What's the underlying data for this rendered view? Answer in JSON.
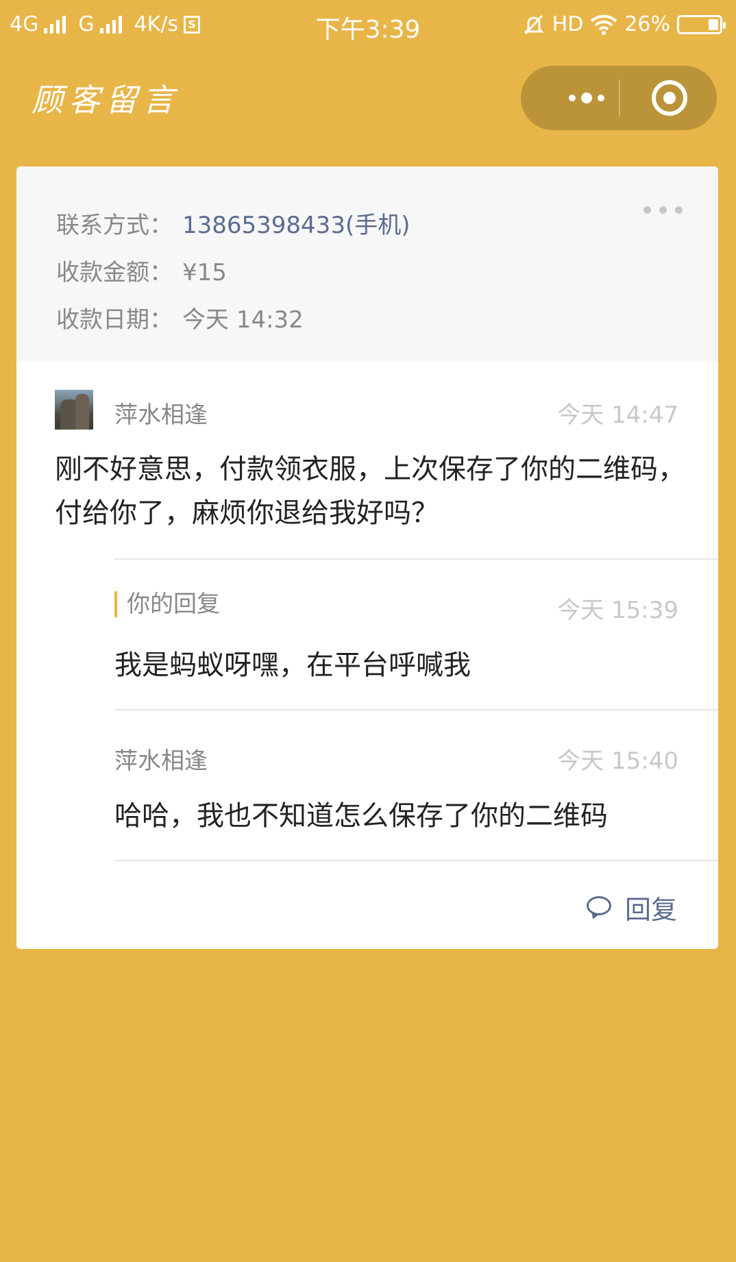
{
  "status_bar": {
    "network1": "4G",
    "network2": "G",
    "speed": "4K/s",
    "sim_icon": "S",
    "time": "下午3:39",
    "hd": "HD",
    "battery": "26%"
  },
  "header": {
    "title": "顾客留言"
  },
  "info": {
    "contact_label": "联系方式：",
    "contact_value": "13865398433(手机)",
    "amount_label": "收款金额：",
    "amount_value": "¥15",
    "date_label": "收款日期：",
    "date_value": "今天 14:32"
  },
  "thread": {
    "first": {
      "name": "萍水相逢",
      "time": "今天 14:47",
      "text": "刚不好意思，付款领衣服，上次保存了你的二维码，付给你了，麻烦你退给我好吗？"
    },
    "reply": {
      "label": "你的回复",
      "time": "今天 15:39",
      "text": "我是蚂蚁呀嘿，在平台呼喊我"
    },
    "second": {
      "name": "萍水相逢",
      "time": "今天 15:40",
      "text": "哈哈，我也不知道怎么保存了你的二维码"
    }
  },
  "actions": {
    "reply_label": "回复"
  },
  "colors": {
    "accent": "#e8b548",
    "link": "#5b6b90"
  }
}
